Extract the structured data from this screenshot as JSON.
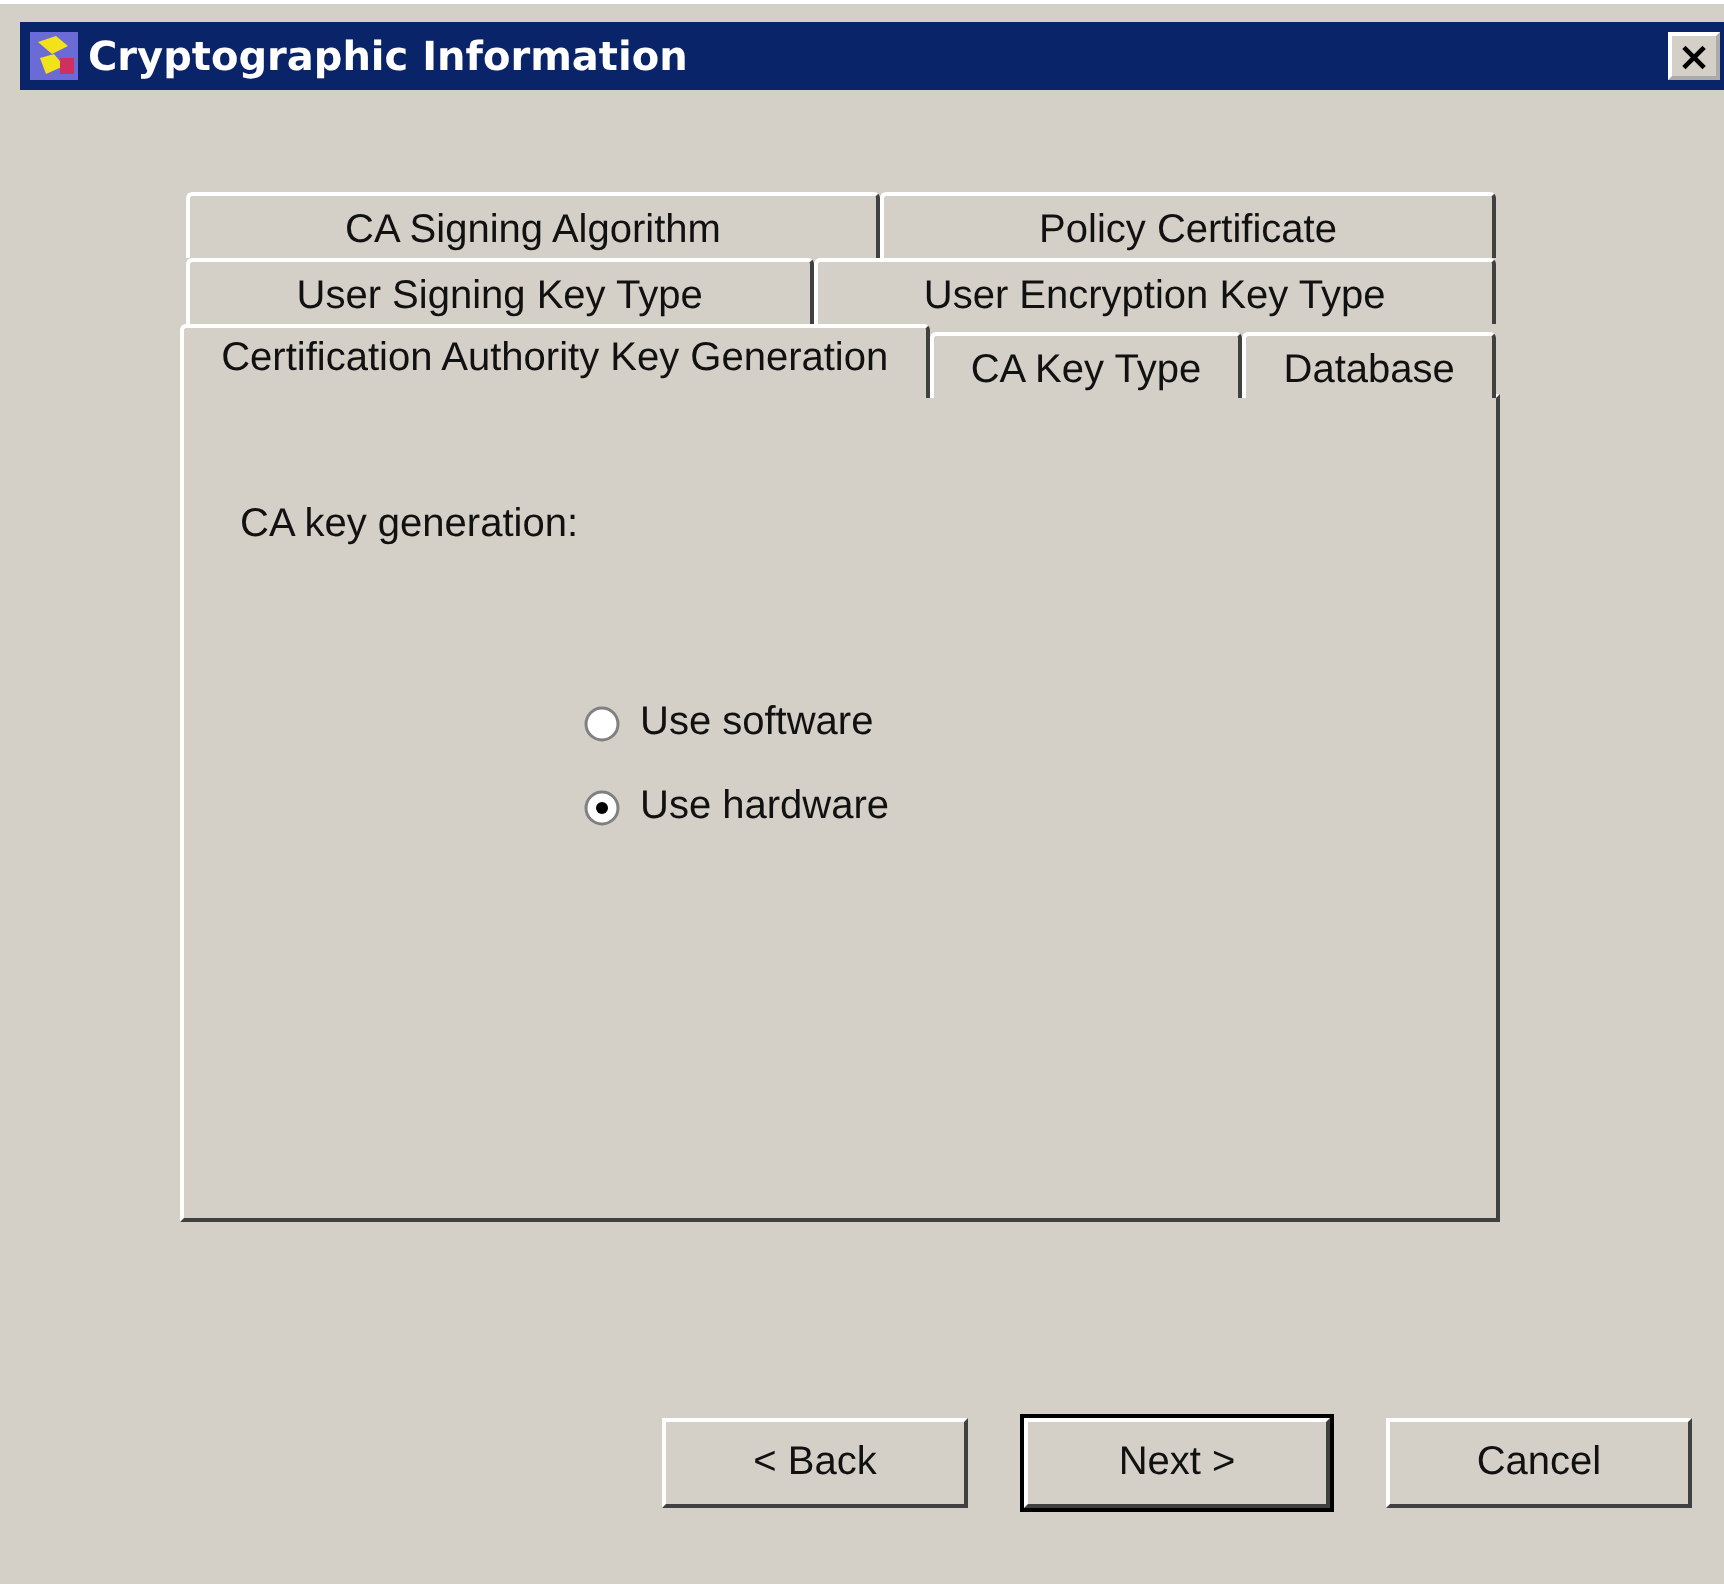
{
  "window": {
    "title": "Cryptographic Information",
    "close": "×"
  },
  "tab_rows": [
    [
      {
        "label": "CA Signing Algorithm",
        "selected": false
      },
      {
        "label": "Policy Certificate",
        "selected": false
      }
    ],
    [
      {
        "label": "User Signing Key Type",
        "selected": false
      },
      {
        "label": "User Encryption Key Type",
        "selected": false
      }
    ],
    [
      {
        "label": "Certification Authority Key Generation",
        "selected": true
      },
      {
        "label": "CA Key Type",
        "selected": false
      },
      {
        "label": "Database",
        "selected": false
      }
    ]
  ],
  "panel": {
    "label": "CA key generation:",
    "options": [
      {
        "label": "Use software",
        "selected": false
      },
      {
        "label": "Use hardware",
        "selected": true
      }
    ]
  },
  "buttons": [
    {
      "label": "< Back",
      "default": false
    },
    {
      "label": "Next >",
      "default": true
    },
    {
      "label": "Cancel",
      "default": false
    }
  ]
}
